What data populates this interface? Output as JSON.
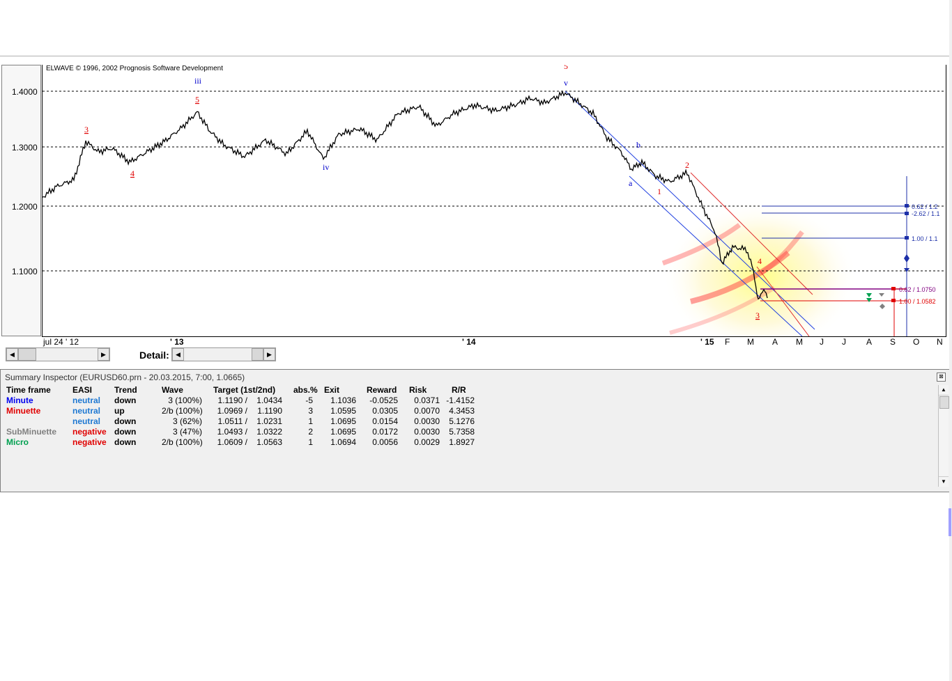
{
  "chart": {
    "copyright": "ELWAVE © 1996, 2002 Prognosis Software Development",
    "y_ticks": [
      "1.4000",
      "1.3000",
      "1.2000",
      "1.1000"
    ],
    "x_ticks": [
      "jul 24 ' 12",
      "' 13",
      "' 14",
      "' 15",
      "F",
      "M",
      "A",
      "M",
      "J",
      "J",
      "A",
      "S",
      "O",
      "N"
    ],
    "wave_labels": {
      "iii": "iii",
      "iv": "iv",
      "v": "v",
      "top": "5",
      "a": "a",
      "b": "b",
      "one": "1",
      "two": "2",
      "three": "3",
      "four": "4",
      "m3": "3",
      "m4": "4",
      "m5": "5"
    },
    "target_labels": {
      "t1": "0.62 / 1.2",
      "t2": "-2.62 / 1.1",
      "t3": "1.00 / 1.1",
      "t4": "0.62 / 1.0750",
      "t5": "1.00 / 1.0582"
    },
    "colors": {
      "blue": "#0000cc",
      "red": "#e00000",
      "grid": "#000000",
      "green": "#00a050"
    }
  },
  "scrollbars": {
    "detail_label": "Detail:",
    "left_arrow": "◀",
    "right_arrow": "▶"
  },
  "inspector": {
    "title": "Summary Inspector (EURUSD60.prn - 20.03.2015, 7:00, 1.0665)",
    "close": "⊠",
    "headers": [
      "Time frame",
      "EASI",
      "Trend",
      "Wave",
      "Target (1st/2nd)",
      "abs.%",
      "Exit",
      "Reward",
      "Risk",
      "R/R"
    ],
    "rows": [
      {
        "tf": "Minute",
        "tf_color": "#0000ee",
        "easi": "neutral",
        "easi_color": "#1e78d2",
        "trend": "down",
        "wave": "3 (100%)",
        "t1": "1.1190 /",
        "t2": "1.0434",
        "abs": "-5",
        "exit": "1.1036",
        "reward": "-0.0525",
        "risk": "0.0371",
        "rr": "-1.4152"
      },
      {
        "tf": "Minuette",
        "tf_color": "#e00000",
        "easi": "neutral",
        "easi_color": "#1e78d2",
        "trend": "up",
        "wave": "2/b (100%)",
        "t1": "1.0969 /",
        "t2": "1.1190",
        "abs": "3",
        "exit": "1.0595",
        "reward": "0.0305",
        "risk": "0.0070",
        "rr": "4.3453"
      },
      {
        "tf": "",
        "tf_color": "#000000",
        "easi": "neutral",
        "easi_color": "#1e78d2",
        "trend": "down",
        "wave": "3 (62%)",
        "t1": "1.0511 /",
        "t2": "1.0231",
        "abs": "1",
        "exit": "1.0695",
        "reward": "0.0154",
        "risk": "0.0030",
        "rr": "5.1276"
      },
      {
        "tf": "SubMinuette",
        "tf_color": "#808080",
        "easi": "negative",
        "easi_color": "#e00000",
        "trend": "down",
        "wave": "3 (47%)",
        "t1": "1.0493 /",
        "t2": "1.0322",
        "abs": "2",
        "exit": "1.0695",
        "reward": "0.0172",
        "risk": "0.0030",
        "rr": "5.7358"
      },
      {
        "tf": "Micro",
        "tf_color": "#00a050",
        "easi": "negative",
        "easi_color": "#e00000",
        "trend": "down",
        "wave": "2/b (100%)",
        "t1": "1.0609 /",
        "t2": "1.0563",
        "abs": "1",
        "exit": "1.0694",
        "reward": "0.0056",
        "risk": "0.0029",
        "rr": "1.8927"
      }
    ],
    "scroll_up": "▲",
    "scroll_down": "▼"
  }
}
